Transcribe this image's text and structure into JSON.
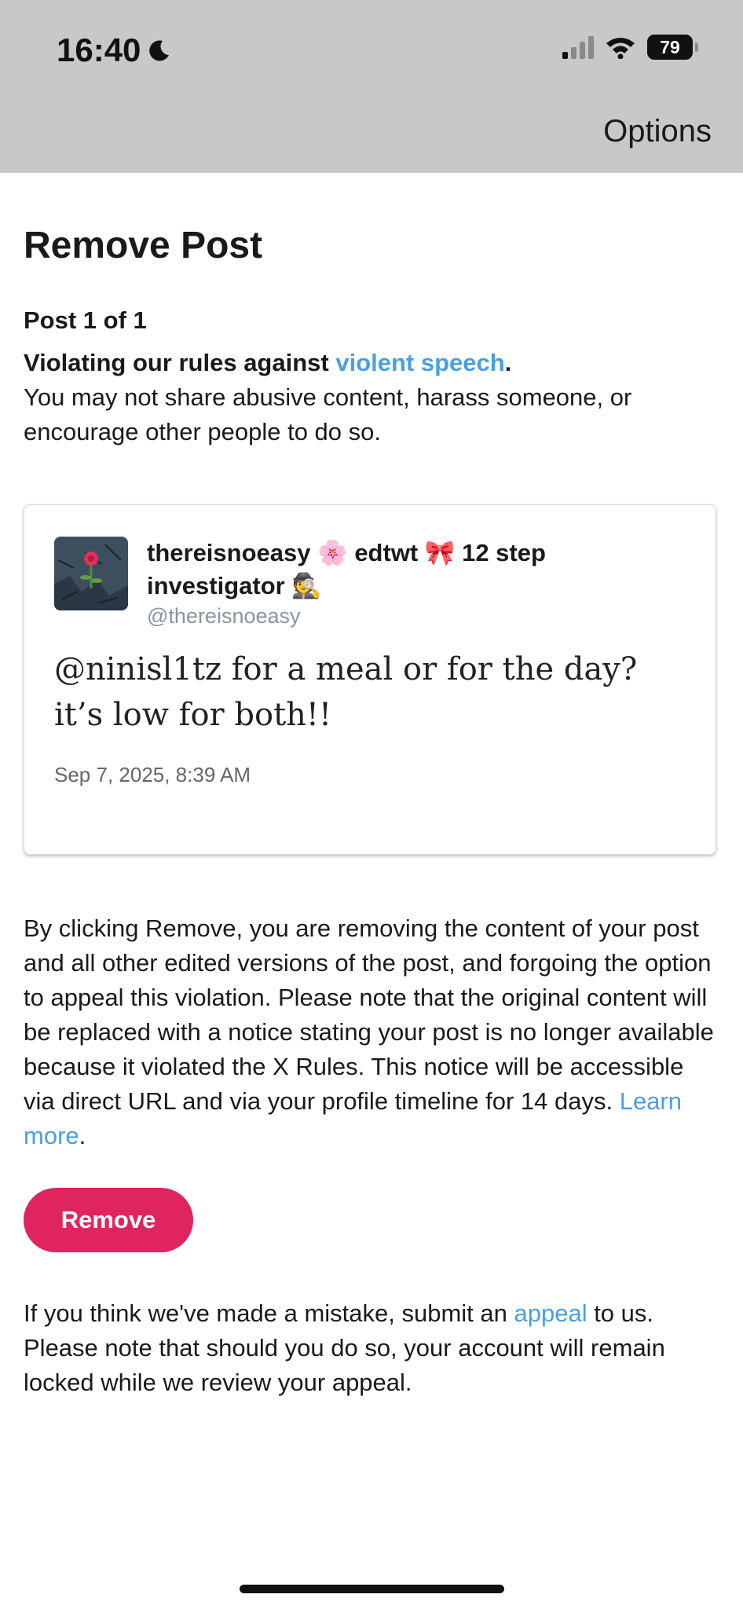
{
  "status_bar": {
    "time": "16:40",
    "battery": "79"
  },
  "header": {
    "options_label": "Options"
  },
  "main": {
    "title": "Remove Post",
    "post_count": "Post 1 of 1",
    "violation_prefix": "Violating our rules against ",
    "violation_link": "violent speech",
    "violation_suffix": ".",
    "violation_description": "You may not share abusive content, harass someone, or encourage other people to do so."
  },
  "post": {
    "author_name": "thereisnoeasy 🌸 edtwt 🎀 12 step investigator 🕵️",
    "handle": "@thereisnoeasy",
    "text": "@ninisl1tz for a meal or for the day? it’s low for both!!",
    "date": "Sep 7, 2025, 8:39 AM"
  },
  "notice": {
    "text": "By clicking Remove, you are removing the content of your post and all other edited versions of the post, and forgoing the option to appeal this violation. Please note that the original content will be replaced with a notice stating your post is no longer available because it violated the X Rules. This notice will be accessible via direct URL and via your profile timeline for 14 days. ",
    "learn_more": "Learn more",
    "end": "."
  },
  "remove_button": {
    "label": "Remove",
    "color": "#e0245e"
  },
  "appeal": {
    "prefix": "If you think we've made a mistake, submit an ",
    "link": "appeal",
    "suffix": " to us. Please note that should you do so, your account will remain locked while we review your appeal."
  },
  "colors": {
    "link": "#4a9fe0",
    "status_bar_bg": "#c8c8c8"
  }
}
